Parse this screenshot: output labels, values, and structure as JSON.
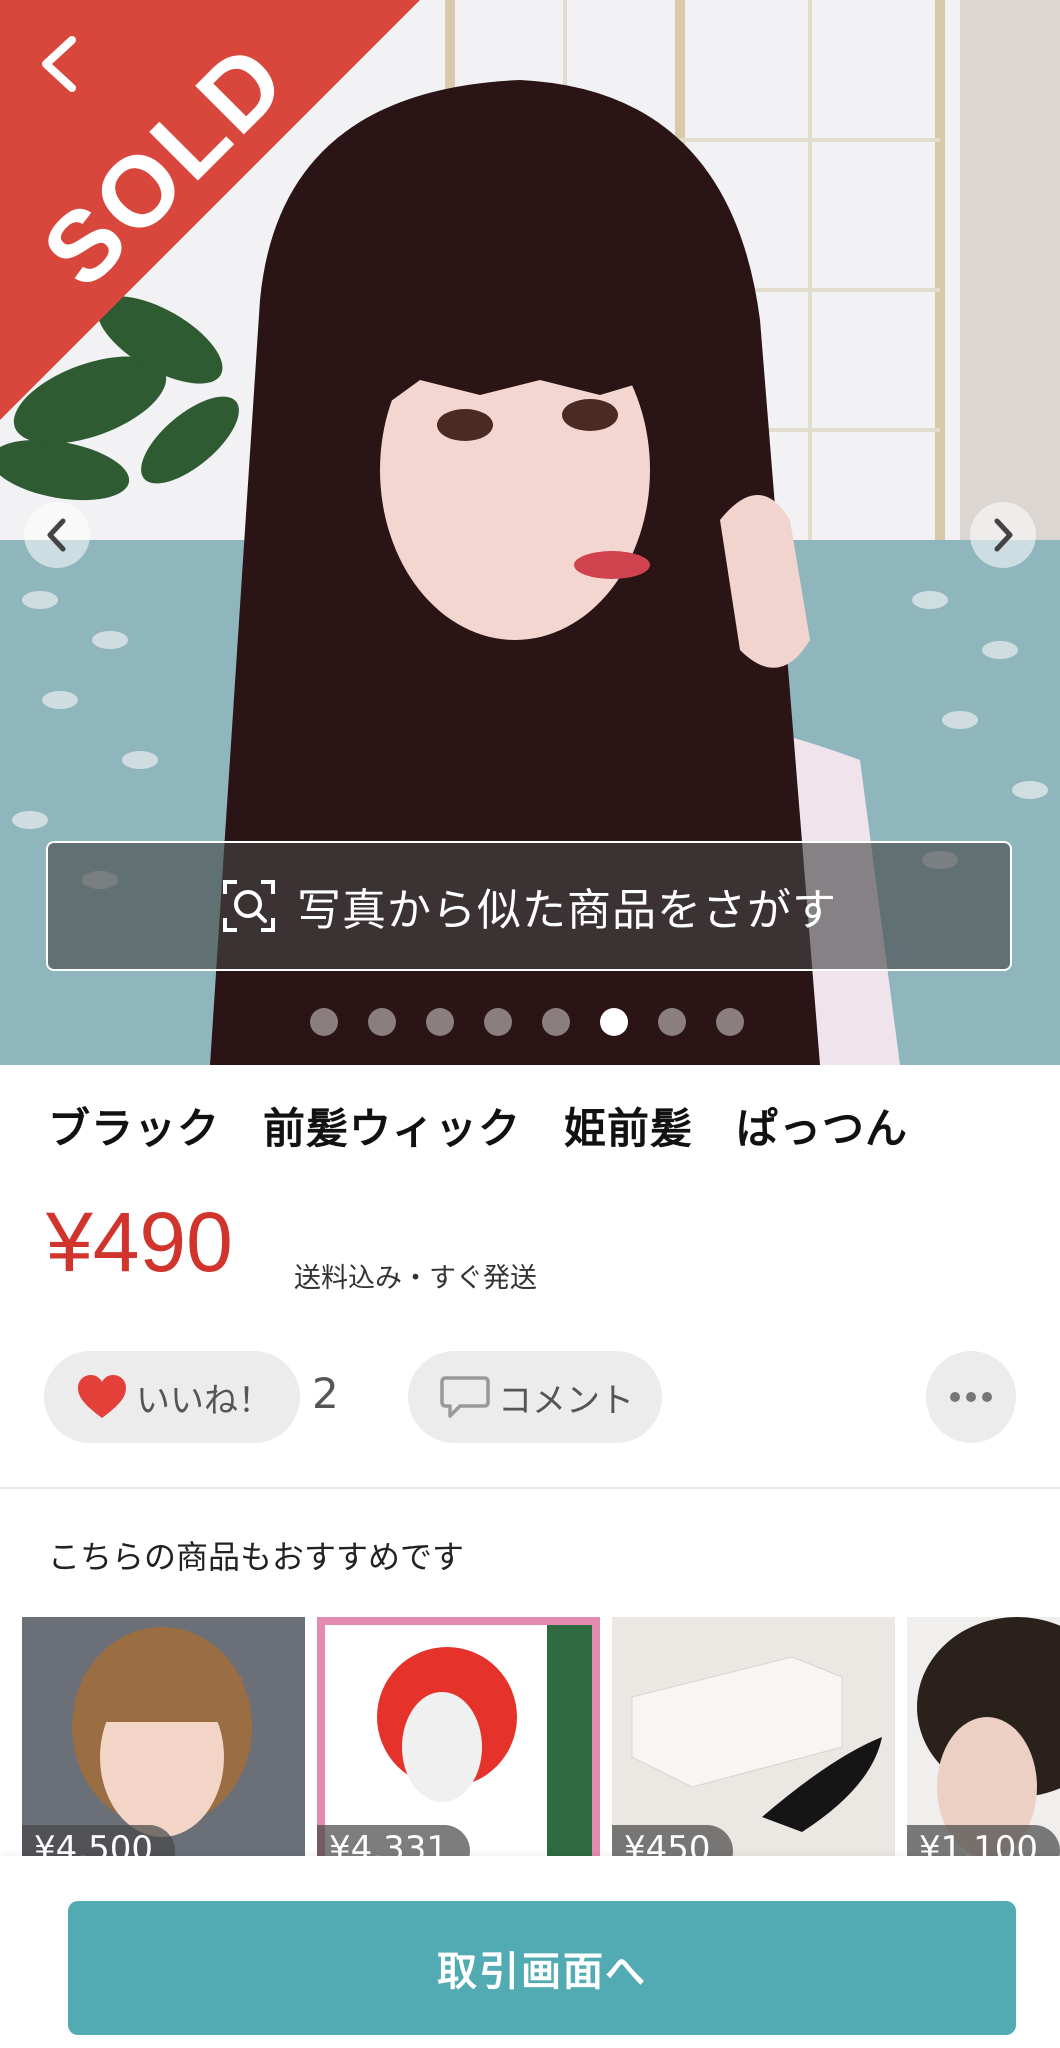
{
  "hero": {
    "sold_label": "SOLD",
    "search_photo_label": "写真から似た商品をさがす",
    "dots_total": 8,
    "dot_active_index": 5
  },
  "product": {
    "title": "ブラック　前髪ウィック　姫前髪　ぱっつん",
    "price": "¥490",
    "price_note": "送料込み・すぐ発送"
  },
  "actions": {
    "like_label": "いいね！",
    "like_count": "2",
    "comment_label": "コメント"
  },
  "recommend": {
    "heading": "こちらの商品もおすすめです",
    "items": [
      {
        "price": "¥4,500"
      },
      {
        "price": "¥4,331"
      },
      {
        "price": "¥450"
      },
      {
        "price": "¥1,100"
      }
    ]
  },
  "bottom": {
    "cta_label": "取引画面へ"
  },
  "colors": {
    "accent_red": "#d0342c",
    "sold_ribbon": "#d9473c",
    "cta_teal": "#52abb3",
    "heart": "#e3403a"
  },
  "icons": [
    "back-chevron-icon",
    "chevron-left-icon",
    "chevron-right-icon",
    "image-search-icon",
    "heart-icon",
    "comment-icon",
    "more-dots-icon"
  ]
}
